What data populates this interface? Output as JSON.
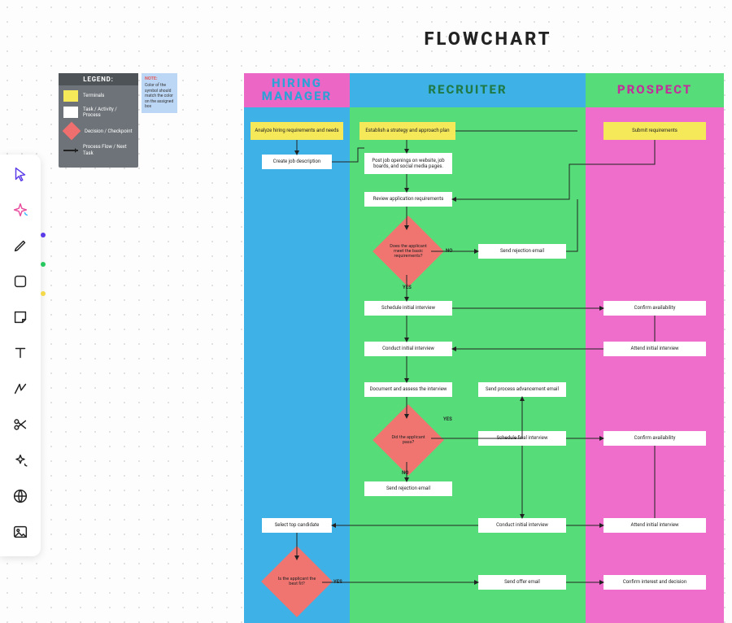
{
  "title": "FLOWCHART",
  "legend": {
    "heading": "LEGEND:",
    "items": {
      "terminal": "Terminals",
      "task": "Task / Activity / Process",
      "decision": "Decision / Checkpoint",
      "flow": "Process Flow / Next Task"
    }
  },
  "note": {
    "heading": "NOTE:",
    "body": "Color of the symbol should match the color on the assigned box"
  },
  "lanes": {
    "hm": "HIRING MANAGER",
    "rec": "RECRUITER",
    "pro": "PROSPECT"
  },
  "nodes": {
    "hm_analyze": "Analyze hiring requirements and needs",
    "hm_create": "Create job description",
    "hm_select": "Select top candidate",
    "hm_bestfit": "Is the applicant the best fit?",
    "rec_strategy": "Establish a strategy and approach plan",
    "rec_post": "Post job openings on website, job boards, and social media pages.",
    "rec_review": "Review application requirements",
    "rec_basic": "Does the applicant meet the basic requirements?",
    "rec_reject1": "Send rejection email",
    "rec_schedule": "Schedule initial interview",
    "rec_conduct1": "Conduct initial interview",
    "rec_document": "Document and assess the interview",
    "rec_pass": "Did the applicant pass?",
    "rec_advance": "Send process advancement email",
    "rec_schedfinal": "Schedule final interview",
    "rec_reject2": "Send rejection email",
    "rec_conduct2": "Conduct initial interview",
    "rec_offer": "Send offer email",
    "pro_submit": "Submit requirements",
    "pro_confirm1": "Confirm availability",
    "pro_attend1": "Attend initial interview",
    "pro_confirm2": "Confirm availability",
    "pro_attend2": "Attend initial interview",
    "pro_confirm3": "Confirm interest and decision"
  },
  "labels": {
    "yes": "YES",
    "no": "NO"
  },
  "toolbar": {
    "dots": {
      "purple": "#5b3be8",
      "green": "#27c860",
      "yellow": "#f3d94b"
    }
  }
}
